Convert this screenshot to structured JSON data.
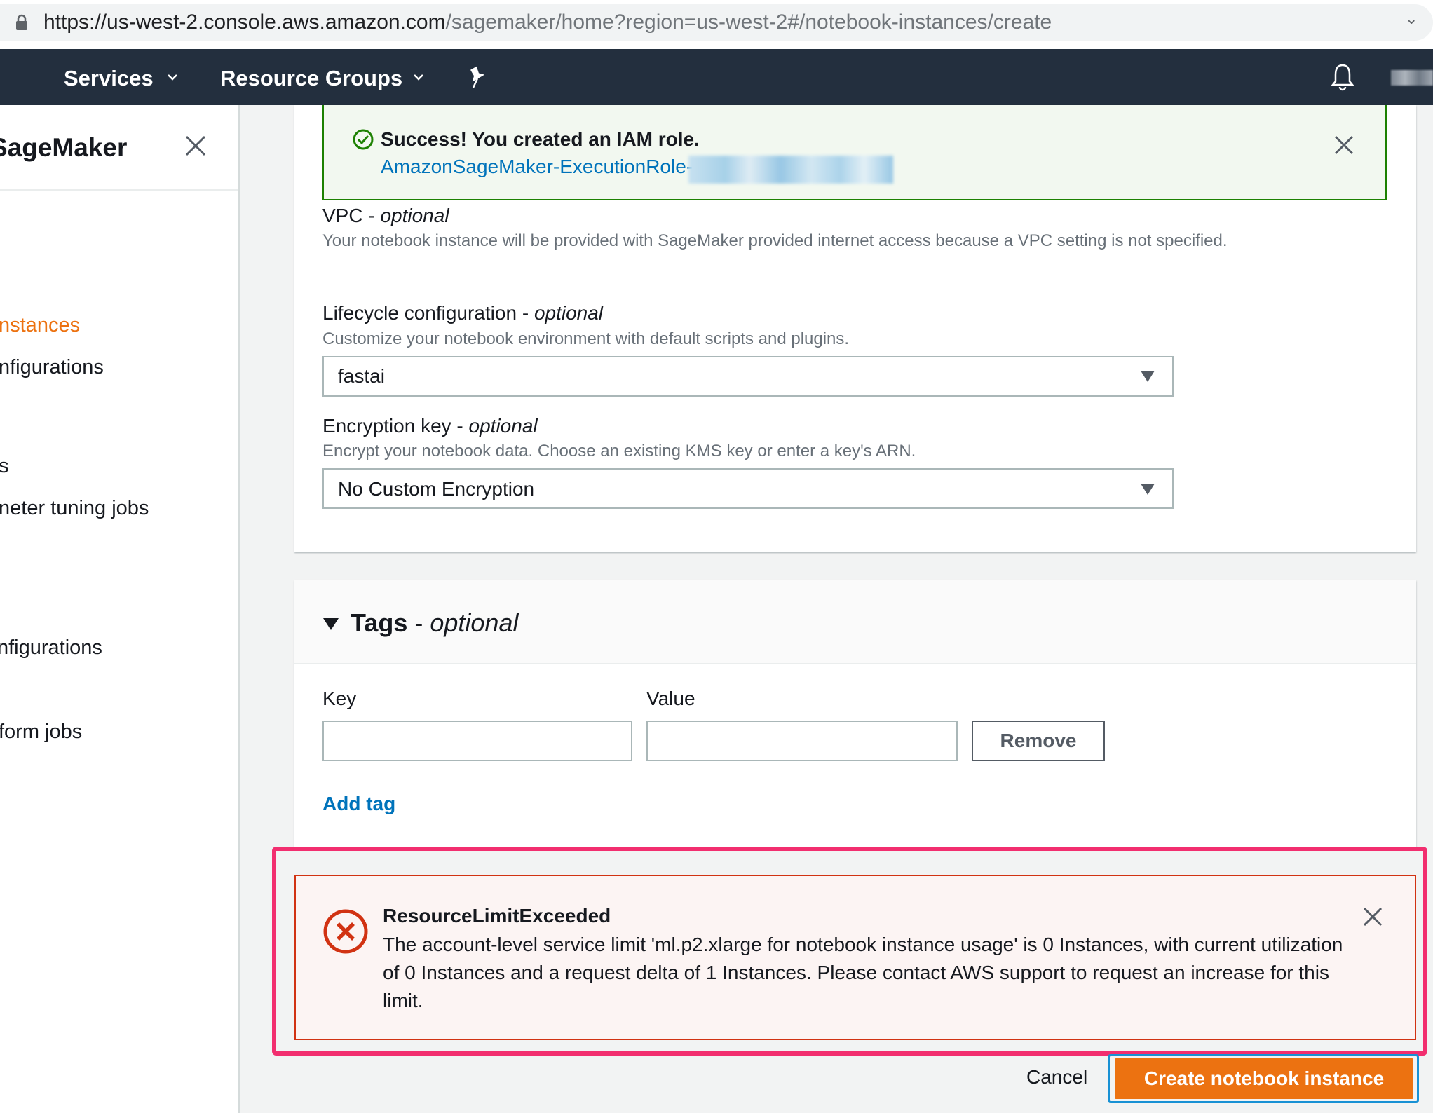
{
  "browser": {
    "url_host": "https://us-west-2.console.aws.amazon.com",
    "url_path": "/sagemaker/home?region=us-west-2#/notebook-instances/create"
  },
  "nav": {
    "services": "Services",
    "resource_groups": "Resource Groups",
    "icons": [
      "pin-icon",
      "bell-icon"
    ]
  },
  "sidebar": {
    "title": "SageMaker",
    "items": [
      {
        "label": "nstances",
        "active": true
      },
      {
        "label": "nfigurations"
      },
      {
        "label": "s"
      },
      {
        "label": "neter tuning jobs"
      },
      {
        "label": "nfigurations"
      },
      {
        "label": "form jobs"
      }
    ]
  },
  "flash": {
    "title": "Success! You created an IAM role.",
    "link": "AmazonSageMaker-ExecutionRole-"
  },
  "vpc": {
    "label": "VPC",
    "optional": "optional",
    "description": "Your notebook instance will be provided with SageMaker provided internet access because a VPC setting is not specified."
  },
  "lifecycle": {
    "label": "Lifecycle configuration",
    "optional": "optional",
    "description": "Customize your notebook environment with default scripts and plugins.",
    "value": "fastai"
  },
  "encryption": {
    "label": "Encryption key",
    "optional": "optional",
    "description": "Encrypt your notebook data. Choose an existing KMS key or enter a key's ARN.",
    "value": "No Custom Encryption"
  },
  "tags": {
    "title": "Tags",
    "optional": "optional",
    "key_label": "Key",
    "value_label": "Value",
    "key_value": "",
    "value_value": "",
    "remove": "Remove",
    "add_tag": "Add tag"
  },
  "error": {
    "title": "ResourceLimitExceeded",
    "message": "The account-level service limit 'ml.p2.xlarge for notebook instance usage' is 0 Instances, with current utilization of 0 Instances and a request delta of 1 Instances. Please contact AWS support to request an increase for this limit."
  },
  "actions": {
    "cancel": "Cancel",
    "create": "Create notebook instance"
  },
  "colors": {
    "nav_bg": "#232f3e",
    "accent_orange": "#ec7211",
    "link_blue": "#0073bb",
    "success_green": "#1d8102",
    "error_red": "#d13212",
    "highlight_pink": "#f22e6f"
  }
}
